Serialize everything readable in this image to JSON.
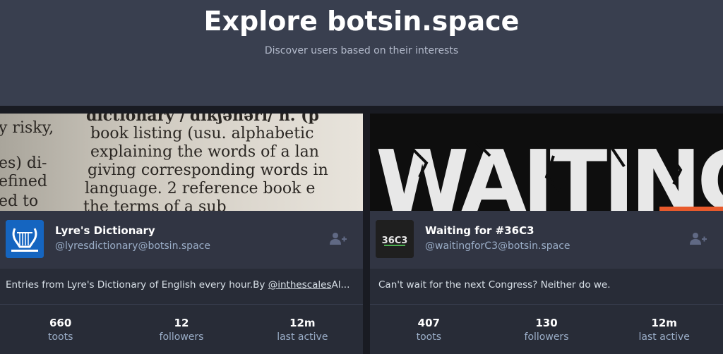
{
  "hero": {
    "title": "Explore botsin.space",
    "subtitle": "Discover users based on their interests"
  },
  "cards": [
    {
      "display_name": "Lyre's Dictionary",
      "acct": "@lyresdictionary@botsin.space",
      "note_prefix": "Entries from Lyre's Dictionary of English every hour.By ",
      "note_link": "@inthescales",
      "note_suffix": "Al...",
      "banner_lines": [
        "dictionary /ˈdɪkʃənərɪ/ n. (p",
        "book listing (usu. alphabetic",
        "explaining the words of a lan",
        "giving corresponding words in",
        "language. 2 reference book e",
        "the  terms  of  a  sub"
      ],
      "banner_side_lines": [
        "y risky,",
        "es) di-",
        "efined",
        "ed  to"
      ],
      "stats": [
        {
          "value": "660",
          "label": "toots"
        },
        {
          "value": "12",
          "label": "followers"
        },
        {
          "value": "12m",
          "label": "last active"
        }
      ]
    },
    {
      "display_name": "Waiting for #36C3",
      "acct": "@waitingforC3@botsin.space",
      "note": "Can't wait for the next Congress? Neither do we.",
      "banner_text": "WAITING",
      "avatar_text": "36C3",
      "stats": [
        {
          "value": "407",
          "label": "toots"
        },
        {
          "value": "130",
          "label": "followers"
        },
        {
          "value": "12m",
          "label": "last active"
        }
      ]
    }
  ],
  "colors": {
    "hero_bg": "#393f4f",
    "card_bg": "#282c37",
    "accent": "#2b90d9",
    "muted": "#9baec8"
  },
  "icons": {
    "follow": "person-add-icon",
    "lyre": "lyre-icon"
  }
}
